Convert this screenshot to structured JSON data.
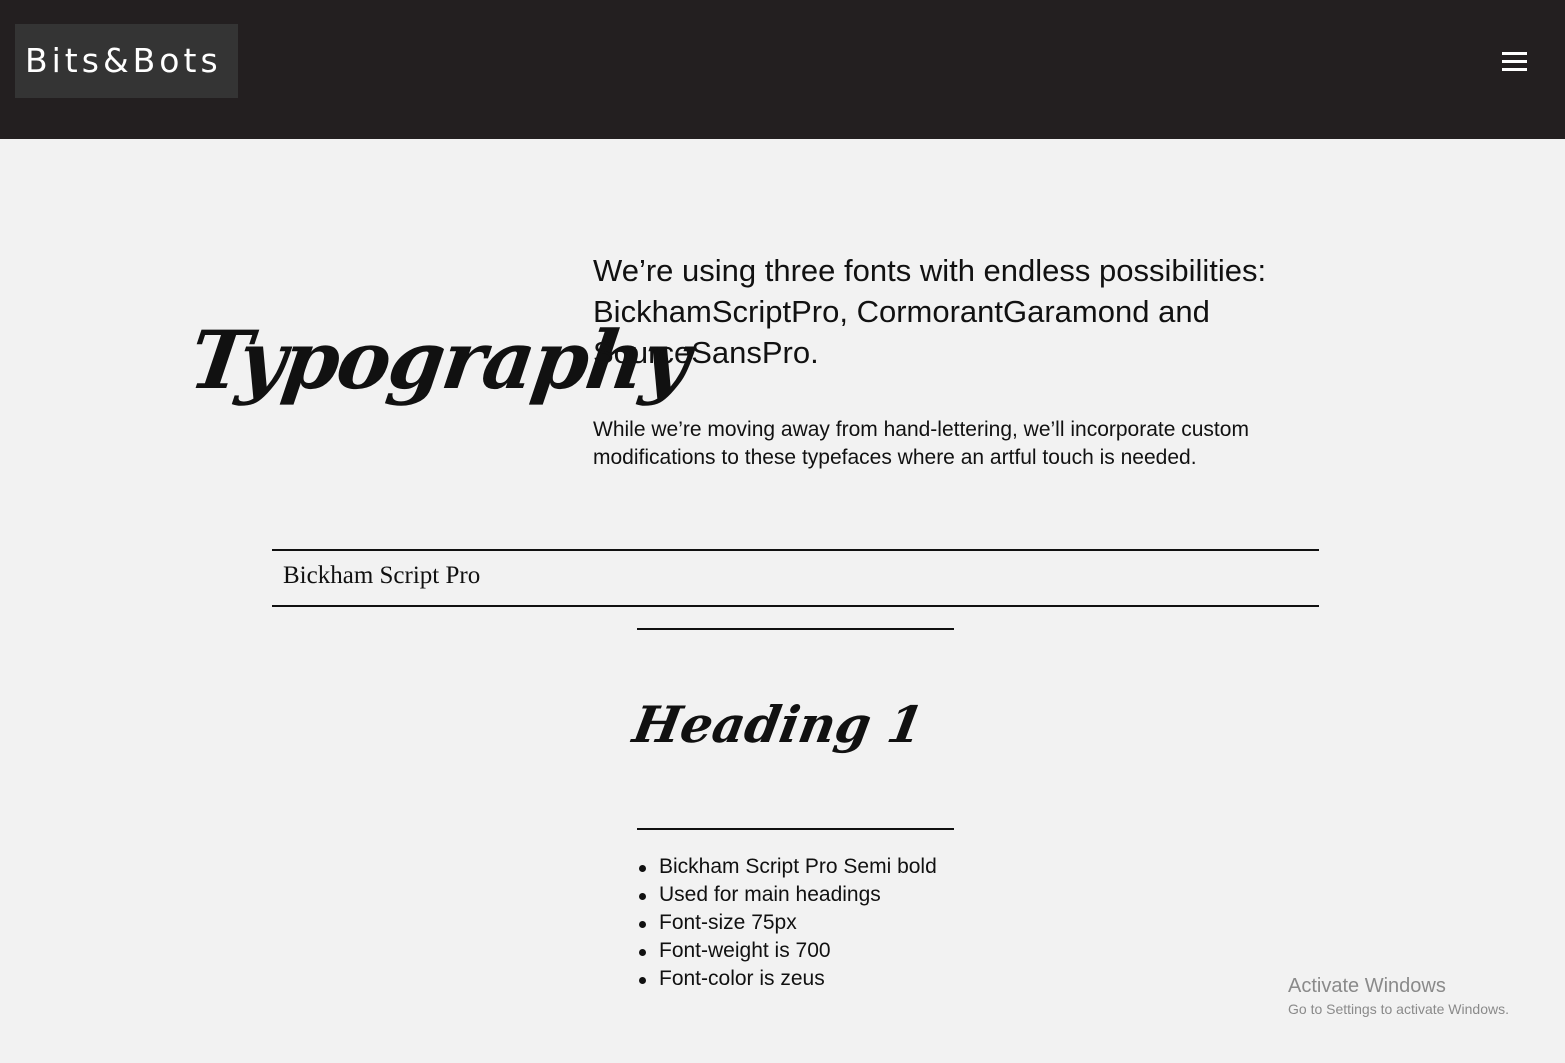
{
  "header": {
    "logo": "Bits&Bots",
    "menu_icon": "hamburger-menu-icon"
  },
  "intro": {
    "script_title": "Typography",
    "lead": "We’re using three fonts with endless possibilities: BickhamScriptPro, CormorantGaramond and SourceSansPro.",
    "body": "While we’re moving away from hand-lettering, we’ll incorporate custom modifications to these typefaces where an artful touch is needed."
  },
  "font_section": {
    "label": "Bickham Script Pro",
    "sample_heading": "Heading 1",
    "specs": [
      "Bickham Script Pro Semi bold",
      "Used for main headings",
      "Font-size 75px",
      "Font-weight is 700",
      "Font-color is zeus"
    ]
  },
  "watermark": {
    "title": "Activate Windows",
    "subtitle": "Go to Settings to activate Windows."
  },
  "colors": {
    "header_bg": "#231f20",
    "logo_bg": "#343434",
    "page_bg": "#f2f2f2",
    "text": "#111111"
  }
}
